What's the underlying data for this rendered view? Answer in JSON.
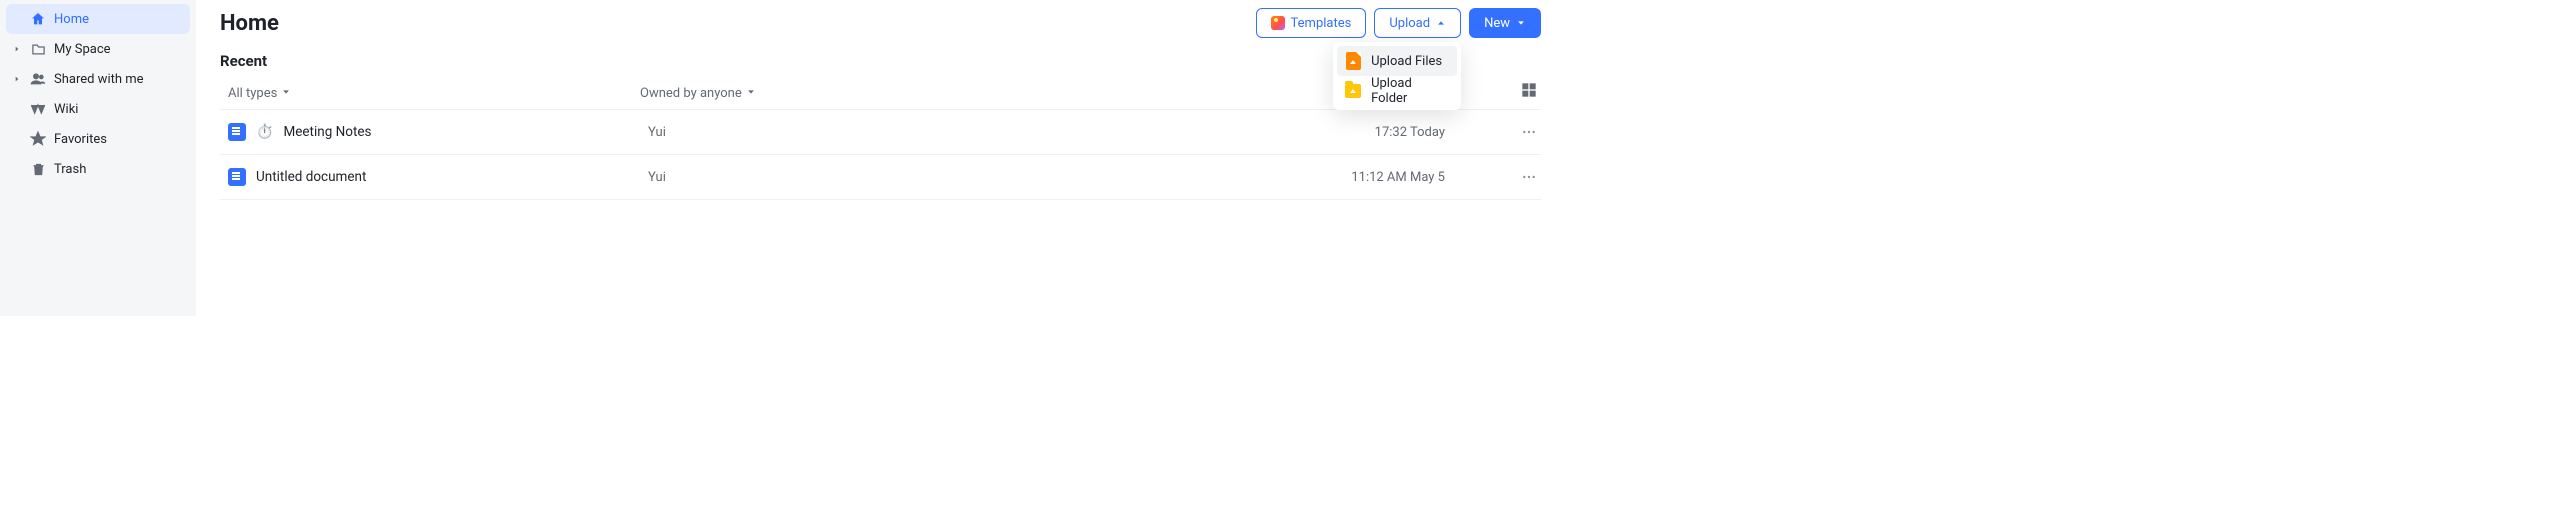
{
  "sidebar": {
    "items": [
      {
        "label": "Home",
        "icon": "home-icon",
        "expandable": false,
        "active": true
      },
      {
        "label": "My Space",
        "icon": "folder-icon",
        "expandable": true,
        "active": false
      },
      {
        "label": "Shared with me",
        "icon": "people-icon",
        "expandable": true,
        "active": false
      },
      {
        "label": "Wiki",
        "icon": "wiki-icon",
        "expandable": false,
        "active": false
      },
      {
        "label": "Favorites",
        "icon": "star-icon",
        "expandable": false,
        "active": false
      },
      {
        "label": "Trash",
        "icon": "trash-icon",
        "expandable": false,
        "active": false
      }
    ]
  },
  "header": {
    "title": "Home",
    "templates_label": "Templates",
    "upload_label": "Upload",
    "new_label": "New"
  },
  "upload_menu": {
    "items": [
      {
        "label": "Upload Files",
        "icon": "upload-file-icon",
        "highlighted": true
      },
      {
        "label": "Upload Folder",
        "icon": "upload-folder-icon",
        "highlighted": false
      }
    ]
  },
  "recent": {
    "section_title": "Recent",
    "filter_type_label": "All types",
    "filter_owner_label": "Owned by anyone",
    "rows": [
      {
        "name": "Meeting Notes",
        "prefix_icon": "timer-icon",
        "owner": "Yui",
        "time": "17:32 Today"
      },
      {
        "name": "Untitled document",
        "prefix_icon": null,
        "owner": "Yui",
        "time": "11:12 AM May 5"
      }
    ]
  }
}
